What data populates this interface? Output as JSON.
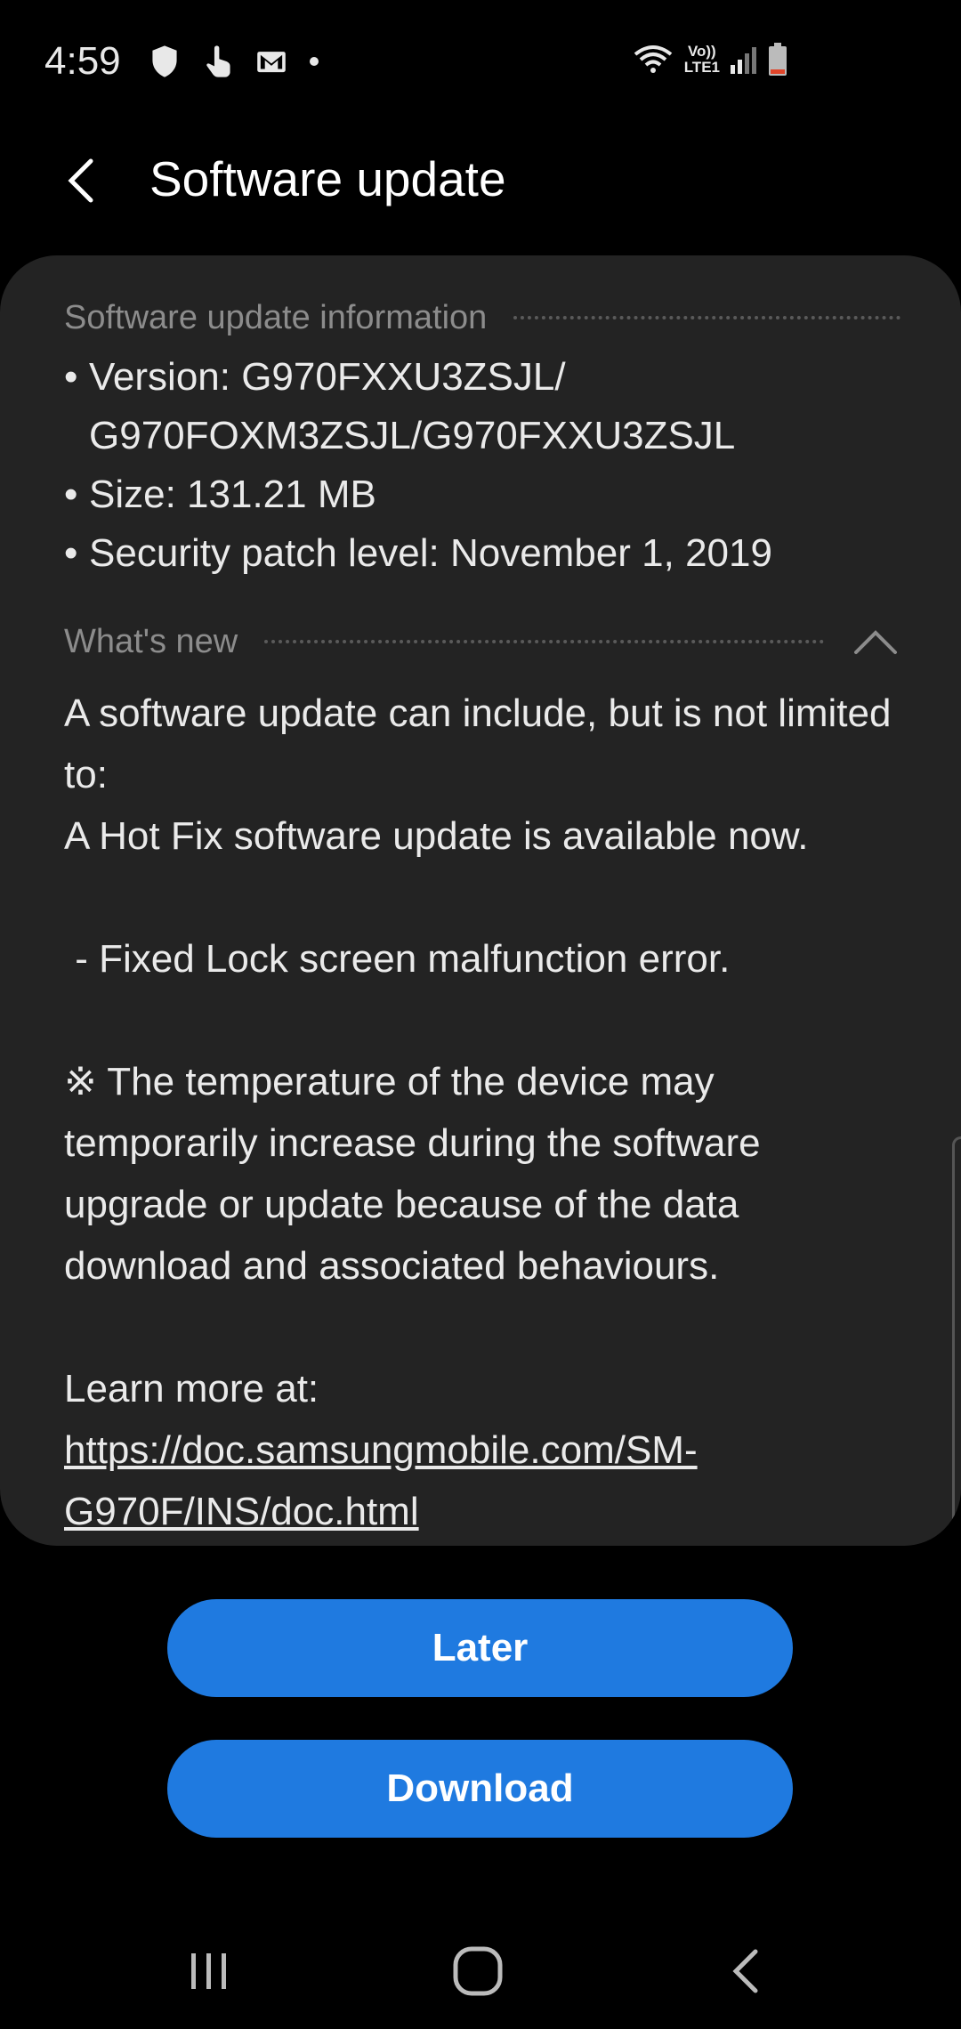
{
  "status_bar": {
    "time": "4:59",
    "network_top": "Vo))",
    "network_bottom": "LTE1"
  },
  "header": {
    "title": "Software update"
  },
  "update_info": {
    "section_title": "Software update information",
    "items": [
      "Version: G970FXXU3ZSJL/\nG970FOXM3ZSJL/G970FXXU3ZSJL",
      "Size: 131.21 MB",
      "Security patch level: November 1, 2019"
    ]
  },
  "whats_new": {
    "section_title": "What's new",
    "body": "A software update can include, but is not limited to:\nA Hot Fix software update is available now.\n\n - Fixed Lock screen malfunction error.\n\n※ The temperature of the device may temporarily increase during the software upgrade or update because of the data download and associated behaviours.\n\nLearn more at:",
    "link": "https://doc.samsungmobile.com/SM-G970F/INS/doc.html"
  },
  "buttons": {
    "later": "Later",
    "download": "Download"
  },
  "colors": {
    "accent": "#1f7ae0",
    "card": "#232323",
    "background": "#000000"
  }
}
